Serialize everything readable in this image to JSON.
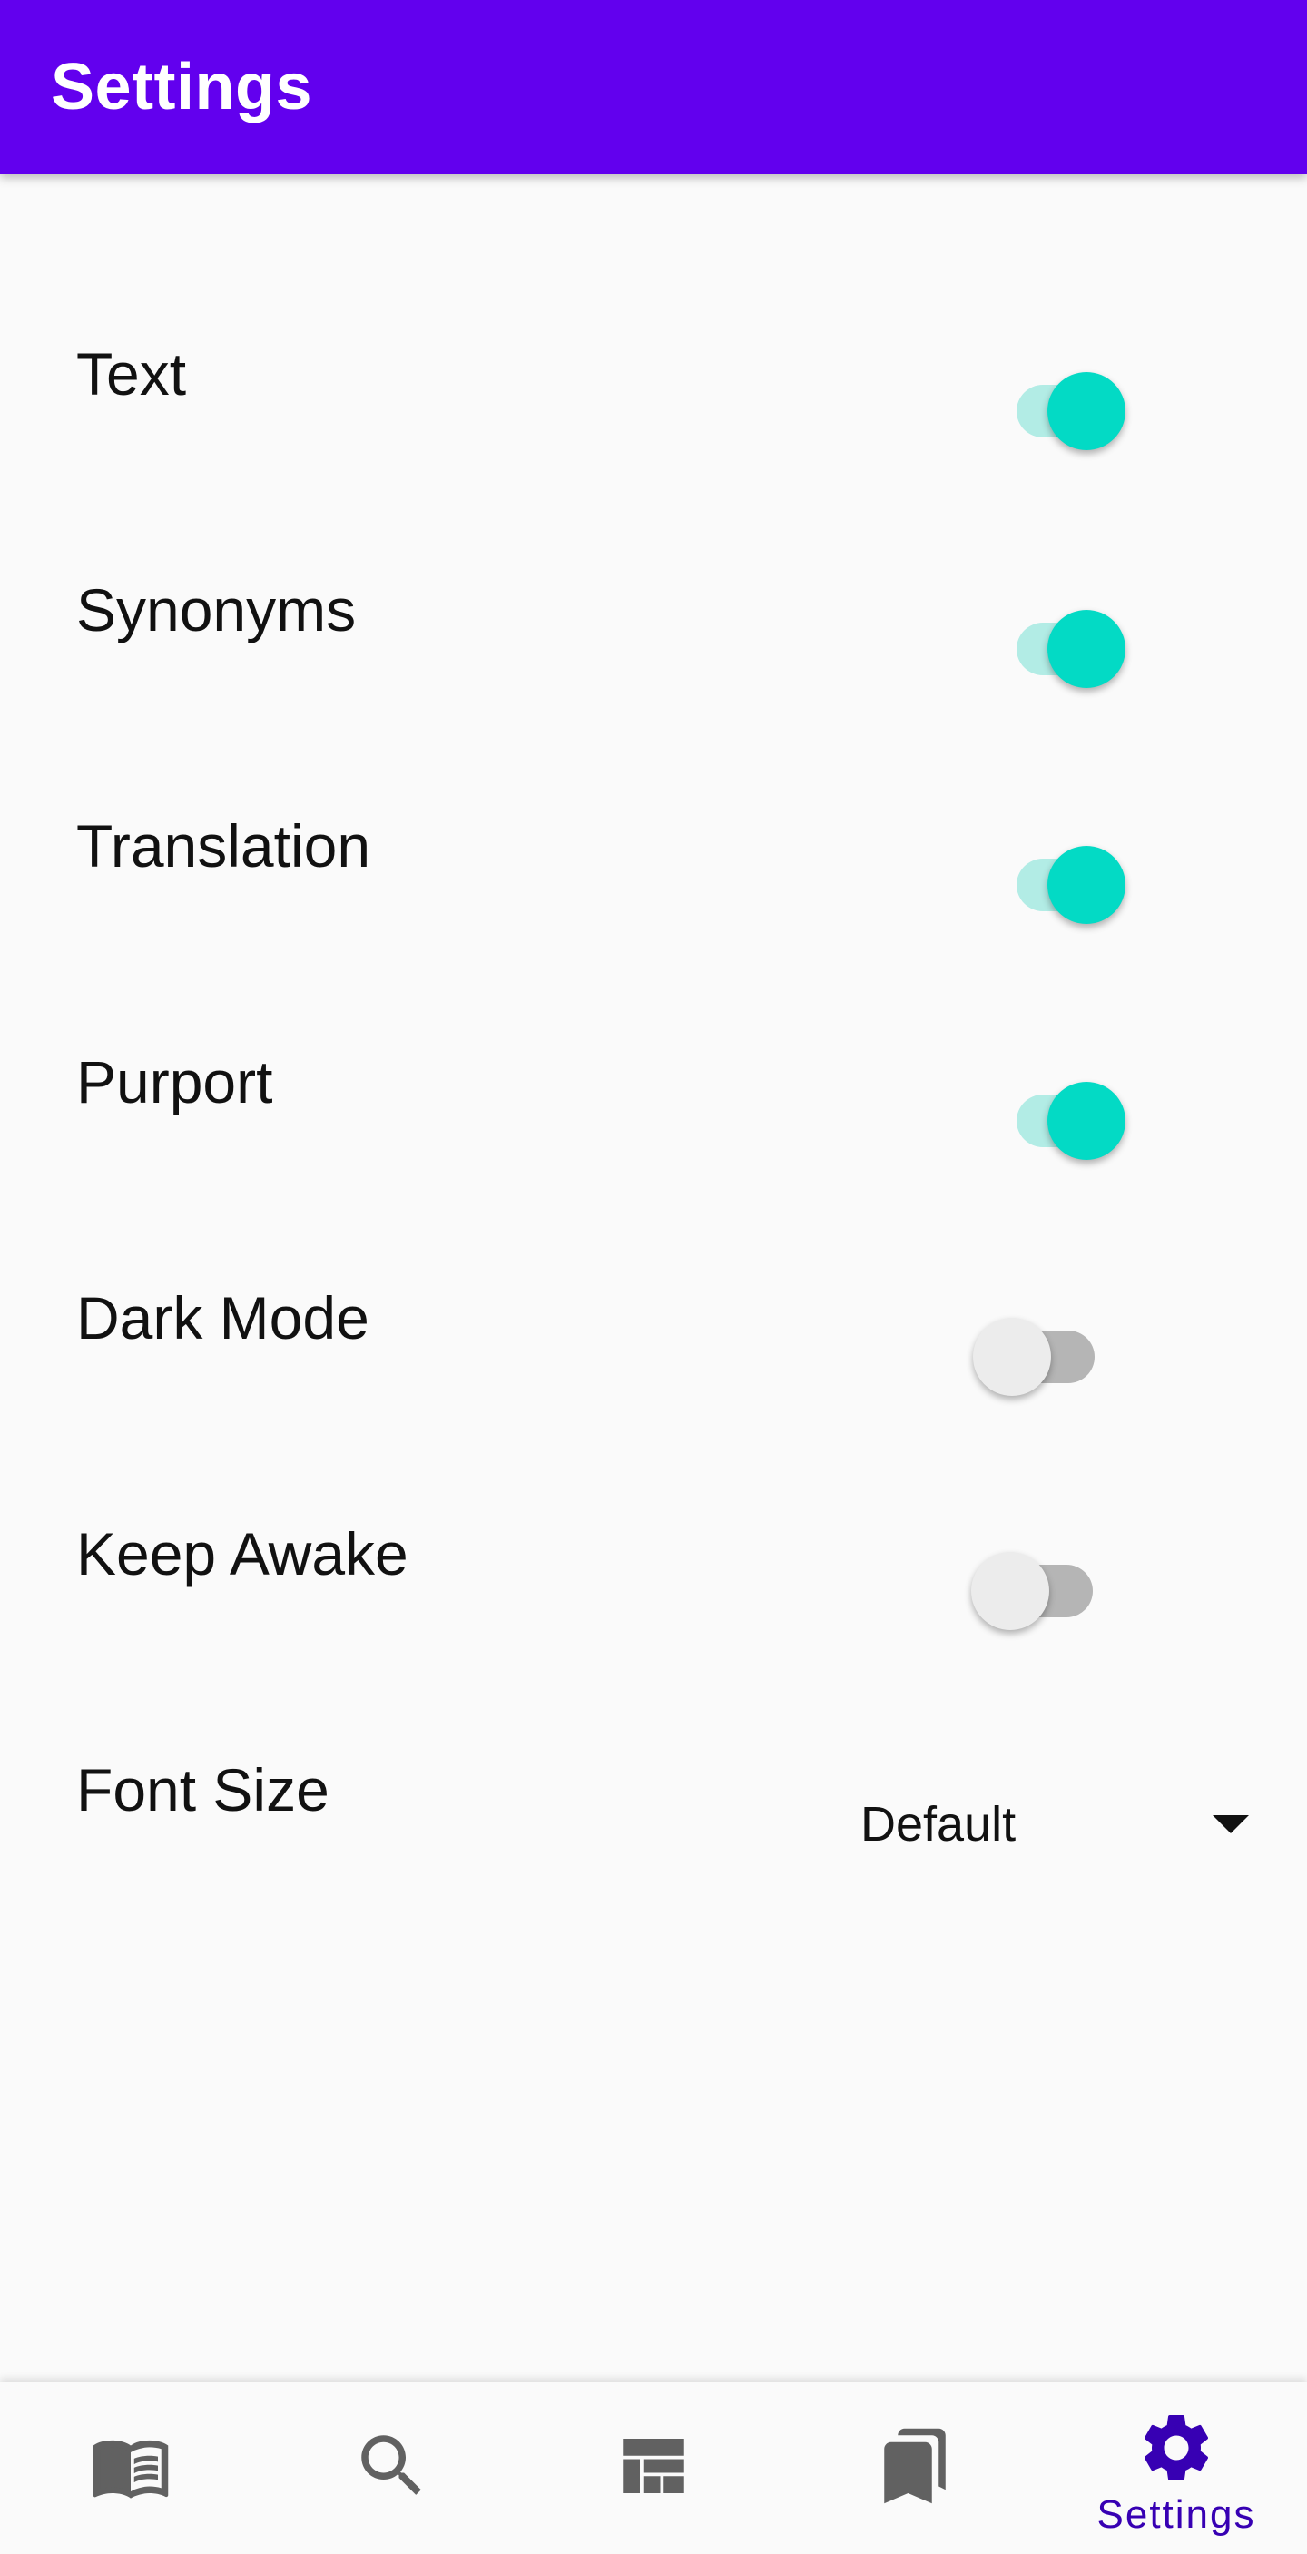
{
  "app_bar": {
    "title": "Settings",
    "color": "#6200ee"
  },
  "settings": [
    {
      "label": "Text",
      "enabled": true
    },
    {
      "label": "Synonyms",
      "enabled": true
    },
    {
      "label": "Translation",
      "enabled": true
    },
    {
      "label": "Purport",
      "enabled": true
    },
    {
      "label": "Dark Mode",
      "enabled": false
    },
    {
      "label": "Keep Awake",
      "enabled": false
    }
  ],
  "font_size": {
    "label": "Font Size",
    "selected": "Default"
  },
  "switch_colors": {
    "on_thumb": "#03dac5",
    "on_track": "#b2ece5",
    "off_thumb": "#ececec",
    "off_track": "#b5b5b5"
  },
  "bottom_nav": {
    "items": [
      {
        "icon": "book-icon",
        "label": ""
      },
      {
        "icon": "search-icon",
        "label": ""
      },
      {
        "icon": "dashboard-icon",
        "label": ""
      },
      {
        "icon": "bookmarks-icon",
        "label": ""
      },
      {
        "icon": "gear-icon",
        "label": "Settings",
        "active": true
      }
    ],
    "active_color": "#3700b3",
    "inactive_color": "#616161"
  }
}
